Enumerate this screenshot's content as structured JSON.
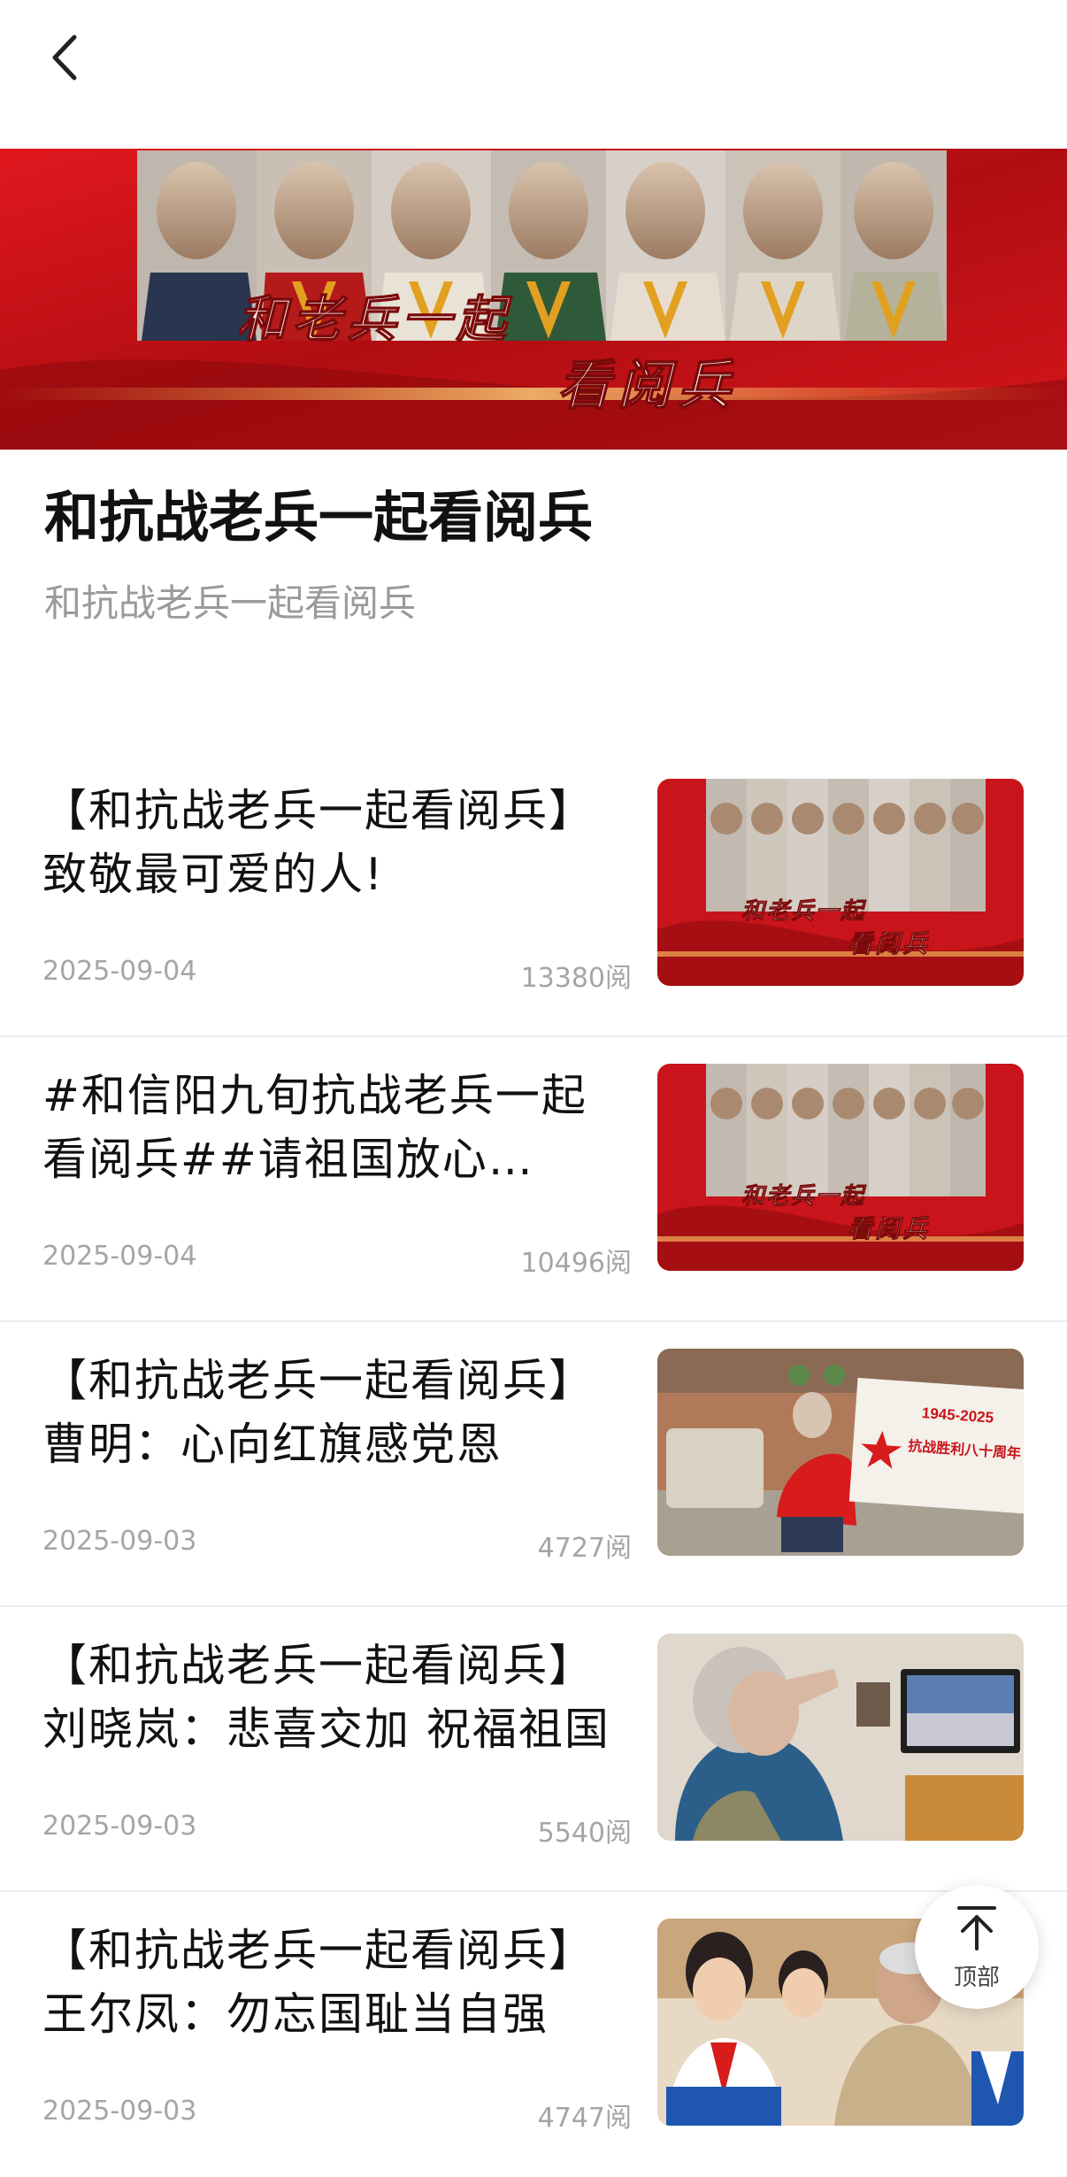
{
  "banner": {
    "headline_line1": "和老兵一起",
    "headline_line2": "看阅兵"
  },
  "page": {
    "title": "和抗战老兵一起看阅兵",
    "subtitle": "和抗战老兵一起看阅兵"
  },
  "articles": [
    {
      "title": "【和抗战老兵一起看阅兵】致敬最可爱的人!",
      "date": "2025-09-04",
      "views": "13380阅",
      "thumb": "banner"
    },
    {
      "title": "#和信阳九旬抗战老兵一起看阅兵##请祖国放心…",
      "date": "2025-09-04",
      "views": "10496阅",
      "thumb": "banner"
    },
    {
      "title": "【和抗战老兵一起看阅兵】曹明：心向红旗感党恩",
      "date": "2025-09-03",
      "views": "4727阅",
      "thumb": "poster"
    },
    {
      "title": "【和抗战老兵一起看阅兵】刘晓岚：悲喜交加 祝福祖国",
      "date": "2025-09-03",
      "views": "5540阅",
      "thumb": "salute"
    },
    {
      "title": "【和抗战老兵一起看阅兵】王尔凤：勿忘国耻当自强",
      "date": "2025-09-03",
      "views": "4747阅",
      "thumb": "children"
    }
  ],
  "thumb_text": {
    "poster_years": "1945-2025",
    "poster_caption": "抗战胜利八十周年"
  },
  "back_to_top": {
    "label": "顶部"
  },
  "colors": {
    "accent_red": "#c8141a",
    "meta_gray": "#a5a5a5"
  },
  "icons": {
    "back": "chevron-left-icon",
    "to_top": "arrow-up-to-line-icon"
  }
}
